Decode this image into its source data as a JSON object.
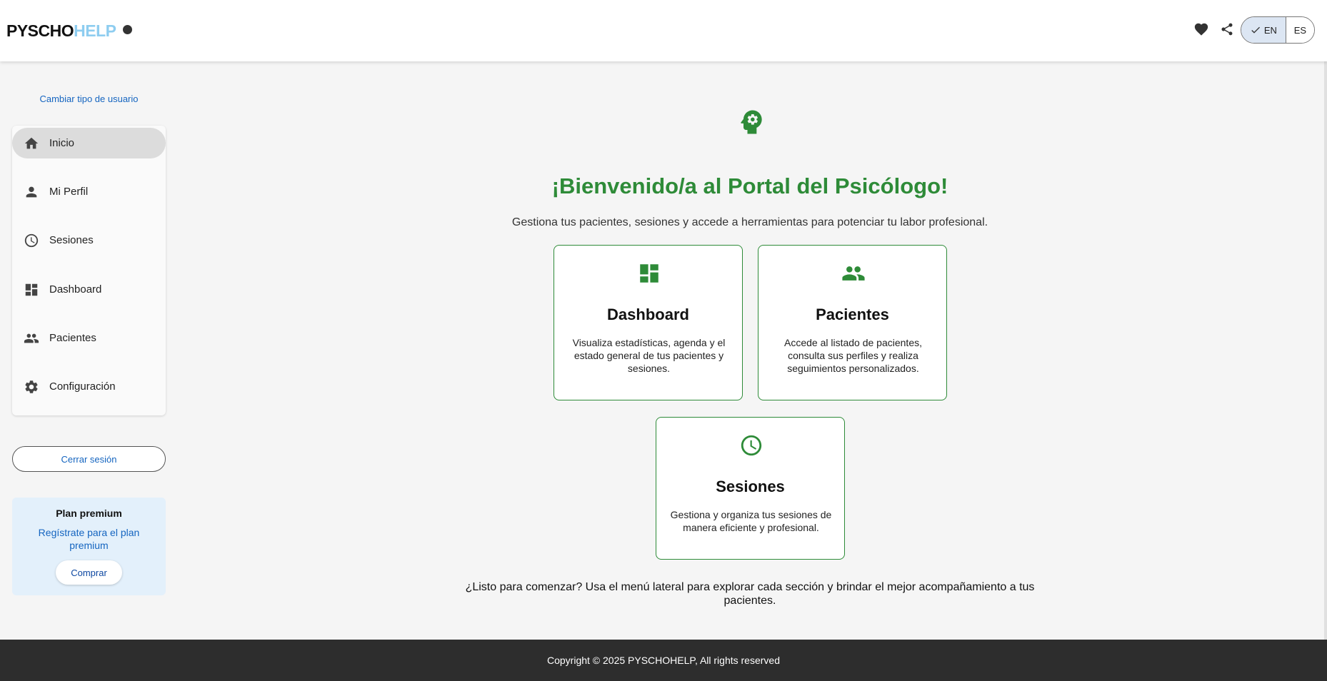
{
  "header": {
    "logo_part1": "PYSCHO",
    "logo_part2": "HELP",
    "icons": [
      "heart-icon",
      "share-icon"
    ],
    "language": {
      "options": [
        "EN",
        "ES"
      ],
      "selected": "EN"
    }
  },
  "sidebar": {
    "switch_user": "Cambiar tipo de usuario",
    "items": [
      {
        "label": "Inicio",
        "icon": "home-icon",
        "active": true
      },
      {
        "label": "Mi Perfil",
        "icon": "person-icon"
      },
      {
        "label": "Sesiones",
        "icon": "clock-icon"
      },
      {
        "label": "Dashboard",
        "icon": "dashboard-icon"
      },
      {
        "label": "Pacientes",
        "icon": "people-icon"
      },
      {
        "label": "Configuración",
        "icon": "gear-icon"
      }
    ],
    "logout": "Cerrar sesión",
    "premium": {
      "title": "Plan premium",
      "subtitle": "Regístrate para el plan premium",
      "button": "Comprar"
    }
  },
  "main": {
    "title": "¡Bienvenido/a al Portal del Psicólogo!",
    "subtitle": "Gestiona tus pacientes, sesiones y accede a herramientas para potenciar tu labor profesional.",
    "cards": [
      {
        "title": "Dashboard",
        "description": "Visualiza estadísticas, agenda y el estado general de tus pacientes y sesiones.",
        "icon": "dashboard-icon"
      },
      {
        "title": "Pacientes",
        "description": "Accede al listado de pacientes, consulta sus perfiles y realiza seguimientos personalizados.",
        "icon": "people-icon"
      },
      {
        "title": "Sesiones",
        "description": "Gestiona y organiza tus sesiones de manera eficiente y profesional.",
        "icon": "clock-icon"
      }
    ],
    "bottom_text": "¿Listo para comenzar? Usa el menú lateral para explorar cada sección y brindar el mejor acompañamiento a tus pacientes."
  },
  "footer": {
    "copyright": "Copyright © 2025 PYSCHOHELP, All rights reserved"
  },
  "colors": {
    "accent_green": "#2e8b38",
    "link_blue": "#1565c0",
    "logo_blue": "#8ecdf0",
    "footer_bg": "#2d2d2d"
  }
}
